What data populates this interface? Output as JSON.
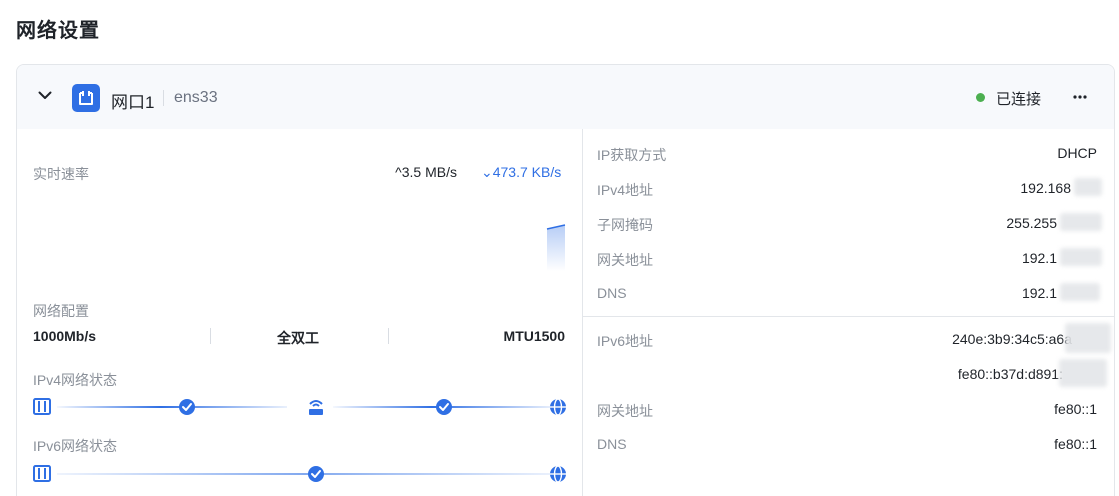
{
  "page_title": "网络设置",
  "interface": {
    "name": "网口1",
    "device": "ens33",
    "status": "已连接",
    "status_color": "#4caf50"
  },
  "speed": {
    "label": "实时速率",
    "upload": "3.5 MB/s",
    "download": "473.7 KB/s"
  },
  "config": {
    "label": "网络配置",
    "speed": "1000Mb/s",
    "duplex": "全双工",
    "mtu": "MTU1500"
  },
  "ipv4_status": {
    "label": "IPv4网络状态"
  },
  "ipv6_status": {
    "label": "IPv6网络状态"
  },
  "ipv4": {
    "method_label": "IP获取方式",
    "method": "DHCP",
    "address_label": "IPv4地址",
    "address": "192.168",
    "mask_label": "子网掩码",
    "mask": "255.255",
    "gateway_label": "网关地址",
    "gateway": "192.1",
    "dns_label": "DNS",
    "dns": "192.1"
  },
  "ipv6": {
    "address_label": "IPv6地址",
    "address_1": "240e:3b9:34c5:a6a",
    "address_2": "fe80::b37d:d891:",
    "gateway_label": "网关地址",
    "gateway": "fe80::1",
    "dns_label": "DNS",
    "dns": "fe80::1"
  },
  "colors": {
    "accent": "#2f6fe4",
    "muted": "#8a9099"
  },
  "icons": {
    "collapse": "chevron-down-icon",
    "port": "ethernet-port-icon",
    "more": "more-horizontal-icon",
    "device": "server-icon",
    "router": "router-icon",
    "check": "check-circle-icon",
    "internet": "globe-icon"
  }
}
